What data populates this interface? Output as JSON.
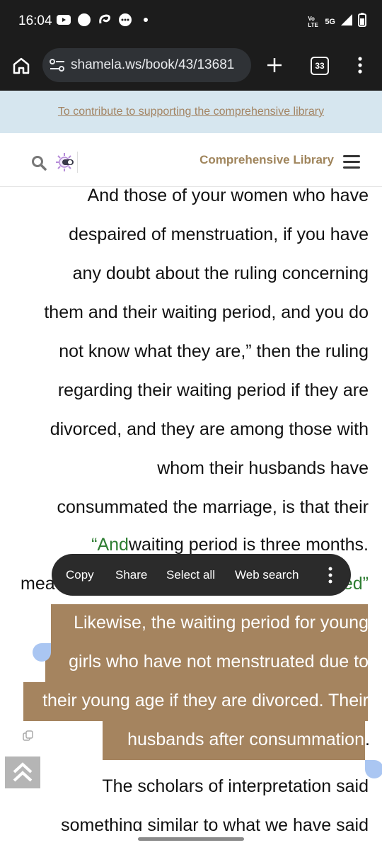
{
  "status_bar": {
    "time": "16:04",
    "network_text": "Vo LTE",
    "network_type": "5G",
    "icons": [
      "youtube-icon",
      "circle-icon",
      "swirl-icon",
      "messenger-icon",
      "dot-icon"
    ]
  },
  "browser": {
    "url": "shamela.ws/book/43/13681",
    "tab_count": "33"
  },
  "banner": {
    "link_text": "To contribute to supporting the comprehensive library"
  },
  "site_header": {
    "title": "Comprehensive Library"
  },
  "article": {
    "lines": [
      "And those of your women who have",
      "despaired of menstruation, if you have",
      "any doubt about the ruling concerning",
      "them and their waiting period, and you do",
      "not know what they are,” then the ruling",
      "regarding their waiting period if they are",
      "divorced, and they are among those with",
      "whom their husbands have",
      "consummated the marriage, is that their"
    ],
    "green_quote": "“And",
    "line_after_green": "waiting period is three months.",
    "partial_left": "mea",
    "partial_right": "ed”",
    "selected_lines": [
      "Likewise, the waiting period for young",
      "girls who have not menstruated due to",
      "their young age if they are divorced. Their",
      "husbands after consummation"
    ],
    "after_selection": ".",
    "lines_after": [
      "The scholars of interpretation said",
      "something similar to what we have said"
    ]
  },
  "context_menu": {
    "items": [
      "Copy",
      "Share",
      "Select all",
      "Web search"
    ]
  },
  "colors": {
    "selection": "#a5845f",
    "green_quote": "#2e7d32",
    "site_title": "#a0855c",
    "banner_bg": "#d6e6ef"
  }
}
